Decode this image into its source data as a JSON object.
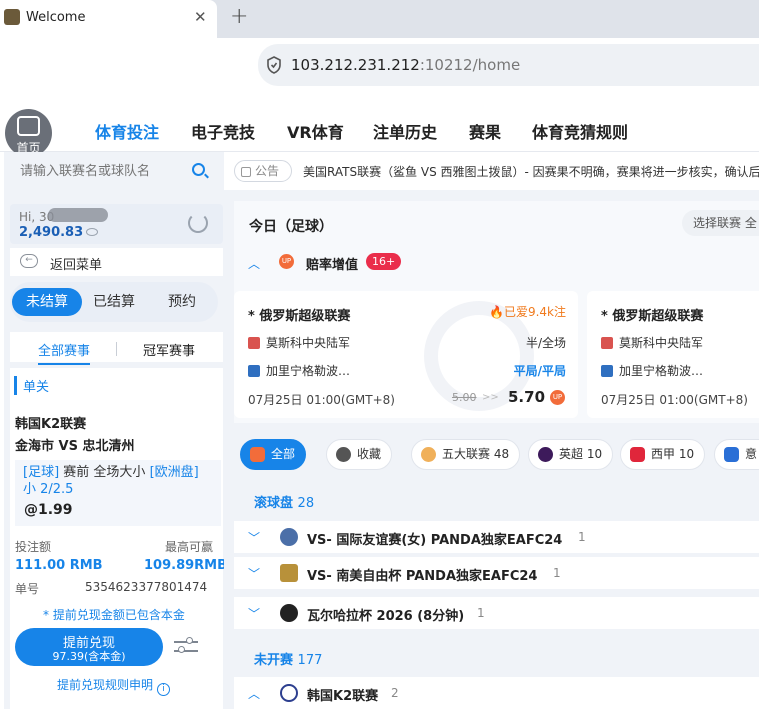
{
  "browser": {
    "tab_title": "Welcome",
    "tab_close": "✕",
    "new_tab": "+",
    "url_host": "103.212.231.212",
    "url_rest": ":10212/home"
  },
  "header": {
    "home_label": "首页",
    "nav": [
      "体育投注",
      "电子竞技",
      "VR体育",
      "注单历史",
      "赛果",
      "体育竞猜规则"
    ]
  },
  "sidebar": {
    "search_placeholder": "请输入联赛名或球队名",
    "greeting": "Hi, 30",
    "balance": "2,490.83",
    "back_label": "返回菜单",
    "status_tabs": [
      "未结算",
      "已结算",
      "预约"
    ],
    "sub_tabs": [
      "全部赛事",
      "冠军赛事"
    ],
    "bet": {
      "type": "单关",
      "league": "韩国K2联赛",
      "match": "金海市 VS 忠北清州",
      "detail_line1_a": "[足球]",
      "detail_line1_b": "赛前 全场大小",
      "detail_line1_c": "[欧洲盘]",
      "detail_line2": "小 2/2.5",
      "odds": "@1.99",
      "stake_label": "投注额",
      "max_label": "最高可赢",
      "stake": "111.00 RMB",
      "max_win": "109.89RMB",
      "order_label": "单号",
      "order_no": "5354623377801474",
      "note": "* 提前兑现金额已包含本金",
      "cashout_label": "提前兑现",
      "cashout_amount": "97.39(含本金)",
      "rules_link": "提前兑现规则申明",
      "info_glyph": "i"
    }
  },
  "main": {
    "notice_label": "公告",
    "notice_text": "美国RATS联赛（鲨鱼 VS 西雅图土拨鼠）- 因赛果不明确，赛果将进一步核实，确认后",
    "today_title": "今日（足球）",
    "select_league": "选择联赛 全",
    "boost_label": "赔率增值",
    "boost_count": "16+",
    "up_badge": "UP",
    "cards": [
      {
        "league": "* 俄罗斯超级联赛",
        "hot": "🔥已爱9.4k注",
        "home": "莫斯科中央陆军",
        "away": "加里宁格勒波…",
        "market": "半/全场",
        "selection": "平局/平局",
        "time": "07月25日 01:00(GMT+8)",
        "old_odds": "5.00",
        "arrow": ">>",
        "new_odds": "5.70"
      },
      {
        "league": "* 俄罗斯超级联赛",
        "home": "莫斯科中央陆军",
        "away": "加里宁格勒波…",
        "time": "07月25日 01:00(GMT+8)"
      }
    ],
    "filters": [
      {
        "label": "全部",
        "count": ""
      },
      {
        "label": "收藏",
        "count": ""
      },
      {
        "label": "五大联赛",
        "count": "48"
      },
      {
        "label": "英超",
        "count": "10"
      },
      {
        "label": "西甲",
        "count": "10"
      },
      {
        "label": "意",
        "count": ""
      }
    ],
    "live_title": "滚球盘",
    "live_count": "28",
    "live_leagues": [
      {
        "name": "VS- 国际友谊赛(女) PANDA独家EAFC24",
        "count": "1"
      },
      {
        "name": "VS- 南美自由杯 PANDA独家EAFC24",
        "count": "1"
      },
      {
        "name": "瓦尔哈拉杯 2026 (8分钟)",
        "count": "1"
      }
    ],
    "upcoming_title": "未开赛",
    "upcoming_count": "177",
    "upcoming_leagues": [
      {
        "name": "韩国K2联赛",
        "count": "2"
      }
    ],
    "chevron_down": "﹀",
    "chevron_up": "︿"
  },
  "colors": {
    "accent": "#1784e8",
    "up_orange": "#f26c3a",
    "badge_red": "#ea2e4b"
  }
}
